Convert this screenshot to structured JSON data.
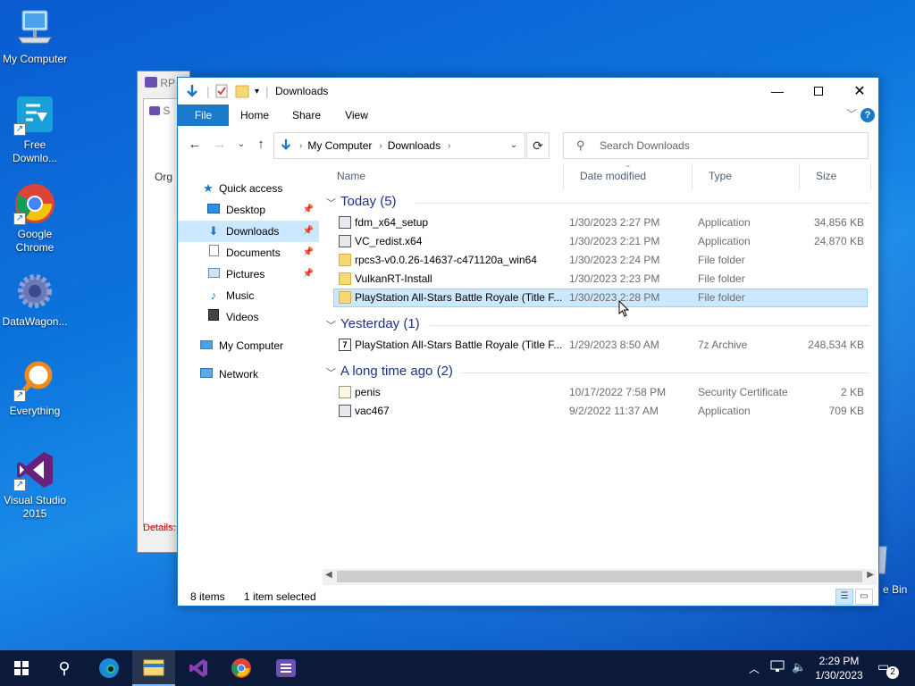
{
  "desktop": {
    "icons": [
      {
        "label": "My Computer"
      },
      {
        "label": "Free Downlo..."
      },
      {
        "label": "Google Chrome"
      },
      {
        "label": "DataWagon..."
      },
      {
        "label": "Everything"
      },
      {
        "label": "Visual Studio 2015"
      }
    ],
    "recycle_label": "e Bin"
  },
  "bg_window": {
    "title": "RP",
    "inner_title": "S",
    "org_label": "Org",
    "details_label": "Details:"
  },
  "explorer": {
    "title": "Downloads",
    "ribbon_tabs": [
      "File",
      "Home",
      "Share",
      "View"
    ],
    "address": {
      "root": "My Computer",
      "folder": "Downloads"
    },
    "search_placeholder": "Search Downloads",
    "nav": {
      "quick_access": "Quick access",
      "items": [
        "Desktop",
        "Downloads",
        "Documents",
        "Pictures",
        "Music",
        "Videos"
      ],
      "my_computer": "My Computer",
      "network": "Network"
    },
    "columns": {
      "name": "Name",
      "date": "Date modified",
      "type": "Type",
      "size": "Size"
    },
    "groups": [
      {
        "label": "Today (5)"
      },
      {
        "label": "Yesterday (1)"
      },
      {
        "label": "A long time ago (2)"
      }
    ],
    "files": [
      {
        "name": "fdm_x64_setup",
        "date": "1/30/2023 2:27 PM",
        "type": "Application",
        "size": "34,856 KB"
      },
      {
        "name": "VC_redist.x64",
        "date": "1/30/2023 2:21 PM",
        "type": "Application",
        "size": "24,870 KB"
      },
      {
        "name": "rpcs3-v0.0.26-14637-c471120a_win64",
        "date": "1/30/2023 2:24 PM",
        "type": "File folder",
        "size": ""
      },
      {
        "name": "VulkanRT-Install",
        "date": "1/30/2023 2:23 PM",
        "type": "File folder",
        "size": ""
      },
      {
        "name": "PlayStation All-Stars Battle Royale (Title F...",
        "date": "1/30/2023 2:28 PM",
        "type": "File folder",
        "size": ""
      },
      {
        "name": "PlayStation All-Stars Battle Royale (Title F...",
        "date": "1/29/2023 8:50 AM",
        "type": "7z Archive",
        "size": "248,534 KB"
      },
      {
        "name": "penis",
        "date": "10/17/2022 7:58 PM",
        "type": "Security Certificate",
        "size": "2 KB"
      },
      {
        "name": "vac467",
        "date": "9/2/2022 11:37 AM",
        "type": "Application",
        "size": "709 KB"
      }
    ],
    "status": {
      "count": "8 items",
      "selection": "1 item selected"
    }
  },
  "taskbar": {
    "time": "2:29 PM",
    "date": "1/30/2023",
    "notification_count": "2"
  },
  "colors": {
    "accent": "#1979ca",
    "selection": "#cce8ff",
    "taskbar": "#0b1a3a"
  }
}
